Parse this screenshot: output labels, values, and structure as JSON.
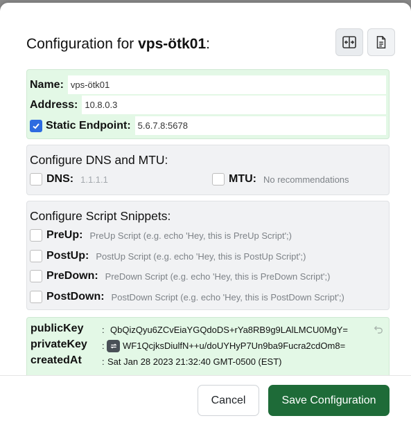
{
  "dialog": {
    "title_prefix": "Configuration for ",
    "title_peer": "vps-ötk01",
    "title_suffix": ":"
  },
  "identity": {
    "name_label": "Name:",
    "name_value": "vps-ötk01",
    "address_label": "Address:",
    "address_value": "10.8.0.3",
    "static_endpoint_label": "Static Endpoint:",
    "static_endpoint_value": "5.6.7.8:5678",
    "static_endpoint_checked": true
  },
  "dns_mtu": {
    "title": "Configure DNS and MTU:",
    "dns_label": "DNS:",
    "dns_placeholder": "1.1.1.1",
    "mtu_label": "MTU:",
    "mtu_placeholder": "No recommendations"
  },
  "scripts": {
    "title": "Configure Script Snippets:",
    "items": [
      {
        "label": "PreUp:",
        "placeholder": "PreUp Script (e.g. echo 'Hey, this is PreUp Script';)"
      },
      {
        "label": "PostUp:",
        "placeholder": "PostUp Script (e.g. echo 'Hey, this is PostUp Script';)"
      },
      {
        "label": "PreDown:",
        "placeholder": "PreDown Script (e.g. echo 'Hey, this is PreDown Script';)"
      },
      {
        "label": "PostDown:",
        "placeholder": "PostDown Script (e.g. echo 'Hey, this is PostDown Script';)"
      }
    ]
  },
  "keys": {
    "public_key_label": "publicKey",
    "public_key_value": "QbQizQyu6ZCvEiaYGQdoDS+rYa8RB9g9LAlLMCU0MgY=",
    "private_key_label": "privateKey",
    "private_key_value": "WF1QcjksDiulfN++u/doUYHyP7Un9ba9Fucra2cdOm8=",
    "created_at_label": "createdAt",
    "created_at_value": "Sat Jan 28 2023 21:32:40 GMT-0500 (EST)",
    "separator": ":"
  },
  "footer": {
    "cancel_label": "Cancel",
    "save_label": "Save Configuration"
  },
  "colors": {
    "accent_blue": "#2d6be0",
    "save_green": "#1e6b38",
    "identity_bg": "#e3f8e6"
  }
}
